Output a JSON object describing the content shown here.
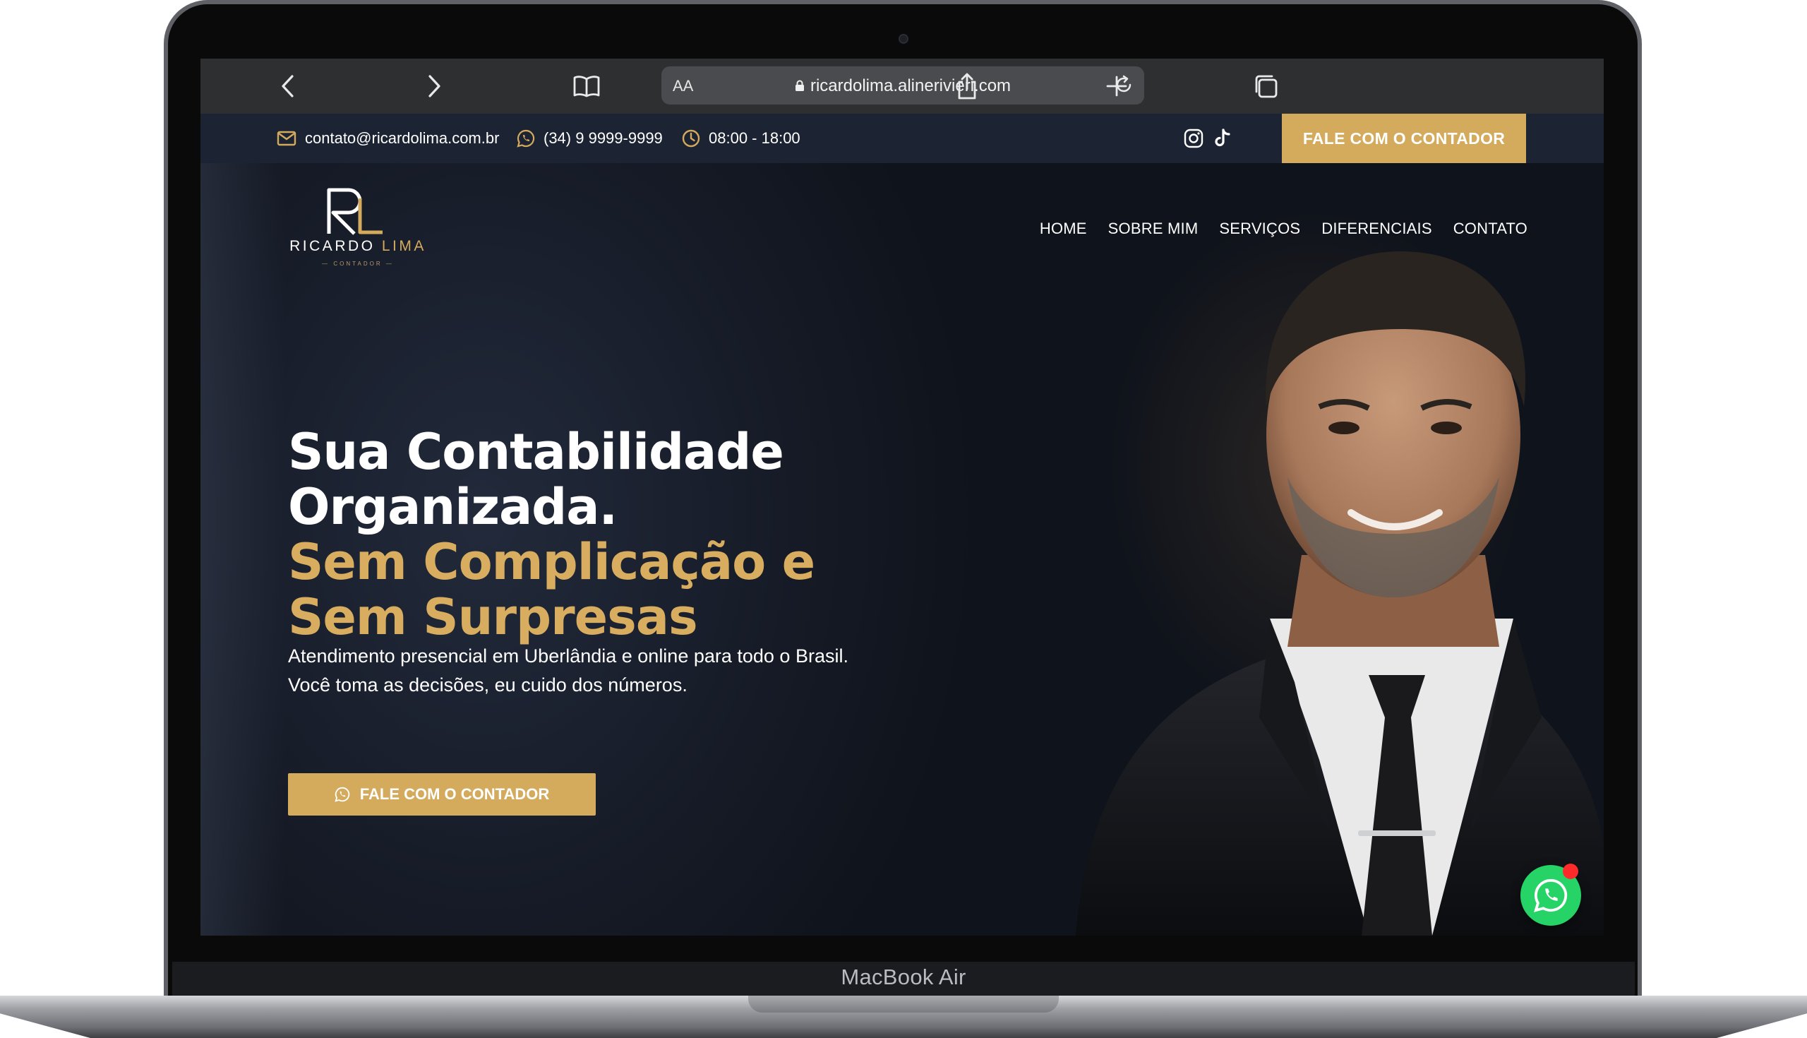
{
  "browser": {
    "url": "ricardolima.alinerivieri.com",
    "reader_label": "AA"
  },
  "device": {
    "label": "MacBook Air"
  },
  "topbar": {
    "email": "contato@ricardolima.com.br",
    "phone": "(34) 9 9999-9999",
    "hours": "08:00 - 18:00",
    "cta": "FALE COM O CONTADOR"
  },
  "logo": {
    "monogram": "RL",
    "name_first": "RICARDO",
    "name_last": "LIMA",
    "tagline": "CONTADOR"
  },
  "nav": {
    "items": [
      "HOME",
      "SOBRE MIM",
      "SERVIÇOS",
      "DIFERENCIAIS",
      "CONTATO"
    ]
  },
  "hero": {
    "line1": "Sua Contabilidade",
    "line2": "Organizada.",
    "line3": "Sem Complicação e",
    "line4": "Sem Surpresas",
    "sub1": "Atendimento presencial em Uberlândia e online para todo o Brasil.",
    "sub2": "Você toma as decisões, eu cuido dos números.",
    "cta": "FALE COM O CONTADOR"
  },
  "icons": {
    "back": "chevron-left-icon",
    "forward": "chevron-right-icon",
    "bookmarks": "book-icon",
    "lock": "lock-icon",
    "reload": "reload-icon",
    "share": "share-icon",
    "new_tab": "plus-icon",
    "tabs": "tabs-icon",
    "email": "mail-icon",
    "whatsapp": "whatsapp-icon",
    "clock": "clock-icon",
    "instagram": "instagram-icon",
    "tiktok": "tiktok-icon"
  },
  "colors": {
    "gold": "#d4aa5c",
    "navy": "#1c2333",
    "whatsapp": "#25d366"
  }
}
